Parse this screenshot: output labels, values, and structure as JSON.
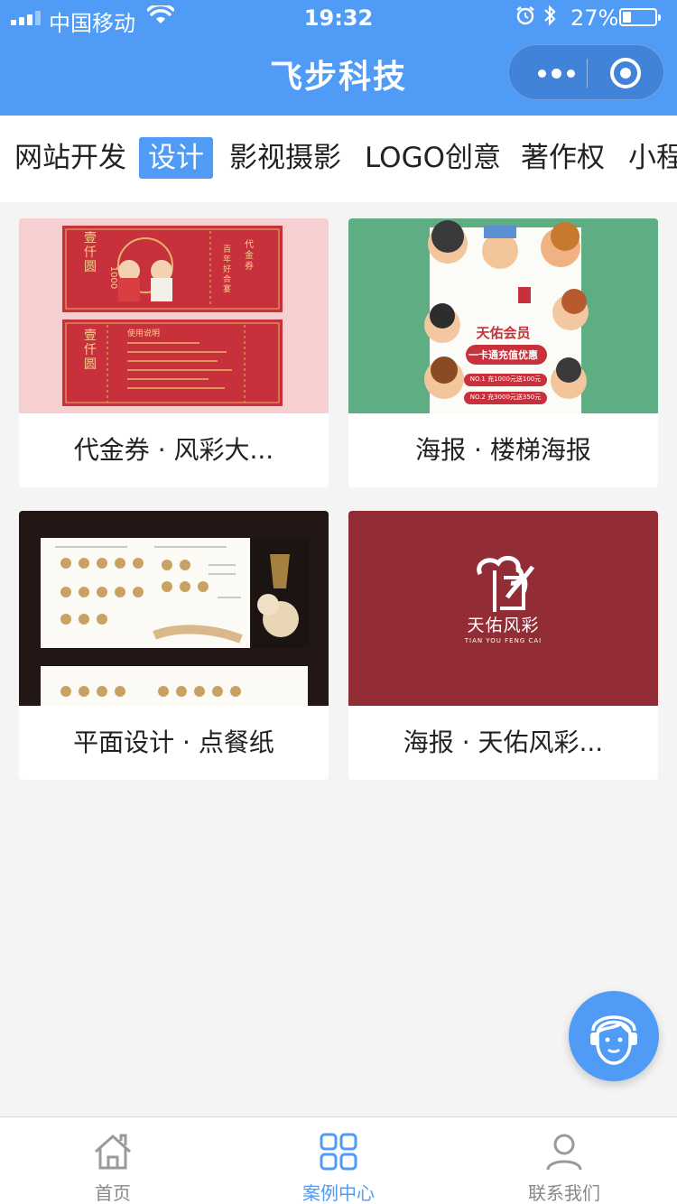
{
  "status_bar": {
    "carrier": "中国移动",
    "time": "19:32",
    "battery_percent": "27%",
    "battery_level": 0.27
  },
  "nav": {
    "title": "飞步科技"
  },
  "tabs": [
    {
      "label": "网站开发",
      "active": false
    },
    {
      "label": "设计",
      "active": true
    },
    {
      "label": "影视摄影",
      "active": false
    },
    {
      "label": "LOGO创意",
      "active": false
    },
    {
      "label": "著作权",
      "active": false
    },
    {
      "label": "小程",
      "active": false
    }
  ],
  "cases": [
    {
      "title": "代金券 · 风彩大...",
      "thumb_texts": [
        "壹仟圆",
        "1000",
        "代金券",
        "百年好合宴",
        "使用说明"
      ]
    },
    {
      "title": "海报 · 楼梯海报",
      "thumb_texts": [
        "天佑会员",
        "一卡通充值优惠",
        "NO.1 充1000元送100元",
        "NO.2 充3000元送350元"
      ]
    },
    {
      "title": "平面设计 · 点餐纸",
      "thumb_texts": []
    },
    {
      "title": "海报 · 天佑风彩...",
      "thumb_texts": [
        "天佑风彩",
        "TIAN YOU FENG CAI"
      ]
    }
  ],
  "tabbar": [
    {
      "label": "首页",
      "icon": "home-icon",
      "active": false
    },
    {
      "label": "案例中心",
      "icon": "grid-icon",
      "active": true
    },
    {
      "label": "联系我们",
      "icon": "user-icon",
      "active": false
    }
  ],
  "colors": {
    "primary": "#4f9bf5",
    "background": "#f4f4f4",
    "card_voucher_bg": "#f6cfd0",
    "card_voucher_red": "#c8313b",
    "card_poster_green": "#5fae83",
    "card_menu_dark": "#231715",
    "card_brand_red": "#922d36"
  }
}
